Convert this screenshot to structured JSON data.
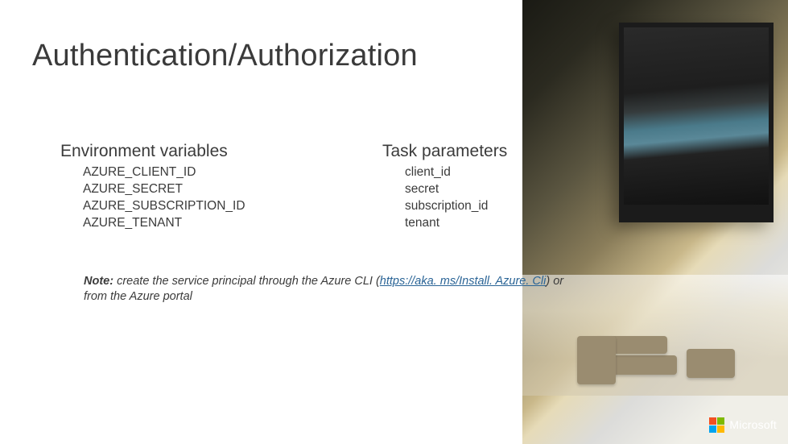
{
  "title": "Authentication/Authorization",
  "columns": {
    "left": {
      "title": "Environment variables",
      "items": [
        "AZURE_CLIENT_ID",
        "AZURE_SECRET",
        "AZURE_SUBSCRIPTION_ID",
        "AZURE_TENANT"
      ]
    },
    "right": {
      "title": "Task parameters",
      "items": [
        "client_id",
        "secret",
        "subscription_id",
        "tenant"
      ]
    }
  },
  "note": {
    "lead": "Note:",
    "pre": " create the service principal through the Azure CLI (",
    "link_text": "https://aka. ms/Install. Azure. Cli",
    "link_href": "https://aka.ms/InstallAzureCli",
    "post": ") or from the Azure portal"
  },
  "footer": {
    "brand": "Microsoft"
  }
}
